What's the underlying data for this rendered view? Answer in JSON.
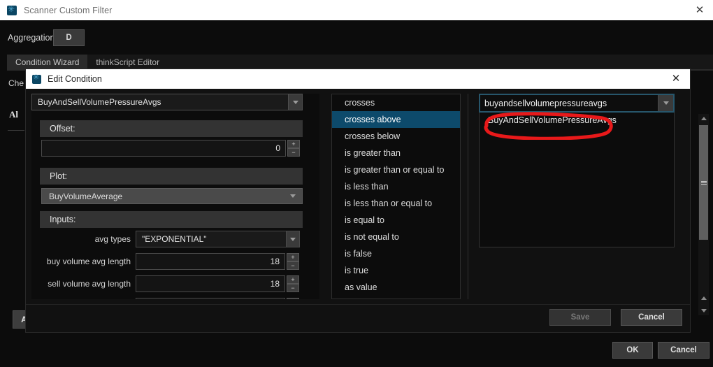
{
  "window": {
    "title": "Scanner Custom Filter",
    "icon": "app-icon",
    "close_label": "✕"
  },
  "aggregation": {
    "label": "Aggregation:",
    "value": "D"
  },
  "tabs": [
    {
      "label": "Condition Wizard",
      "active": true
    },
    {
      "label": "thinkScript Editor",
      "active": false
    }
  ],
  "behind": {
    "check_text": "Che",
    "all_text": "Al",
    "add_button": "A"
  },
  "dialog": {
    "title": "Edit Condition",
    "icon": "app-icon",
    "close_label": "✕",
    "study_combo": {
      "value": "BuyAndSellVolumePressureAvgs"
    },
    "offset": {
      "header": "Offset:",
      "value": "0",
      "plus": "+",
      "minus": "−"
    },
    "plot": {
      "header": "Plot:",
      "value": "BuyVolumeAverage"
    },
    "inputs": {
      "header": "Inputs:",
      "rows": [
        {
          "label": "avg types",
          "value": "\"EXPONENTIAL\"",
          "type": "combo"
        },
        {
          "label": "buy volume avg length",
          "value": "18",
          "type": "spinner"
        },
        {
          "label": "sell volume avg length",
          "value": "18",
          "type": "spinner"
        },
        {
          "label": "",
          "value": "",
          "type": "spinner"
        }
      ]
    },
    "operators": [
      {
        "label": "crosses",
        "selected": false
      },
      {
        "label": "crosses above",
        "selected": true
      },
      {
        "label": "crosses below",
        "selected": false
      },
      {
        "label": "is greater than",
        "selected": false
      },
      {
        "label": "is greater than or equal to",
        "selected": false
      },
      {
        "label": "is less than",
        "selected": false
      },
      {
        "label": "is less than or equal to",
        "selected": false
      },
      {
        "label": "is equal to",
        "selected": false
      },
      {
        "label": "is not equal to",
        "selected": false
      },
      {
        "label": "is false",
        "selected": false
      },
      {
        "label": "is true",
        "selected": false
      },
      {
        "label": "as value",
        "selected": false
      }
    ],
    "search": {
      "value": "buyandsellvolumepressureavgs",
      "placeholder": ""
    },
    "suggestions": [
      {
        "label": "BuyAndSellVolumePressureAvgs",
        "annotated": true
      }
    ],
    "footer": {
      "save": "Save",
      "cancel": "Cancel"
    }
  },
  "footer": {
    "ok": "OK",
    "cancel": "Cancel"
  },
  "colors": {
    "accent_selection": "#0d4a6b",
    "annotation_red": "#e8191a",
    "focus_border": "#27566b",
    "background": "#0c0c0c"
  }
}
